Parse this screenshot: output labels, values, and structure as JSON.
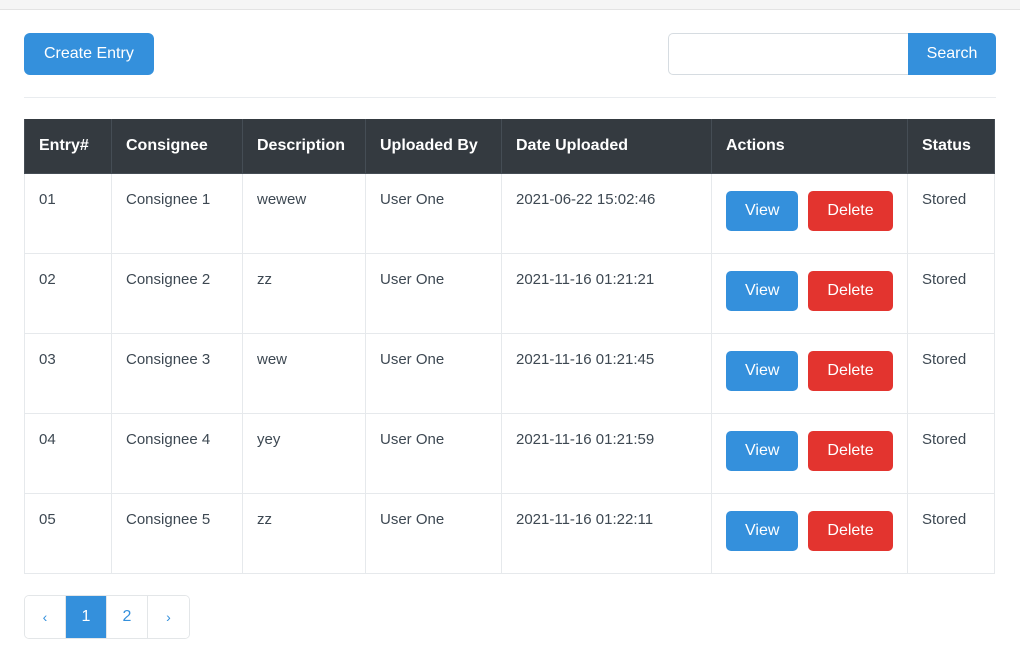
{
  "toolbar": {
    "create_label": "Create Entry",
    "search_value": "",
    "search_placeholder": "",
    "search_label": "Search"
  },
  "table": {
    "columns": [
      "Entry#",
      "Consignee",
      "Description",
      "Uploaded By",
      "Date Uploaded",
      "Actions",
      "Status"
    ],
    "action_labels": {
      "view": "View",
      "delete": "Delete"
    },
    "rows": [
      {
        "entry": "01",
        "consignee": "Consignee 1",
        "description": "wewew",
        "uploaded_by": "User One",
        "date_uploaded": "2021-06-22 15:02:46",
        "status": "Stored"
      },
      {
        "entry": "02",
        "consignee": "Consignee 2",
        "description": "zz",
        "uploaded_by": "User One",
        "date_uploaded": "2021-11-16 01:21:21",
        "status": "Stored"
      },
      {
        "entry": "03",
        "consignee": "Consignee 3",
        "description": "wew",
        "uploaded_by": "User One",
        "date_uploaded": "2021-11-16 01:21:45",
        "status": "Stored"
      },
      {
        "entry": "04",
        "consignee": "Consignee 4",
        "description": "yey",
        "uploaded_by": "User One",
        "date_uploaded": "2021-11-16 01:21:59",
        "status": "Stored"
      },
      {
        "entry": "05",
        "consignee": "Consignee 5",
        "description": "zz",
        "uploaded_by": "User One",
        "date_uploaded": "2021-11-16 01:22:11",
        "status": "Stored"
      }
    ]
  },
  "pagination": {
    "items": [
      {
        "label": "‹",
        "name": "pagination-prev",
        "active": false,
        "arrow": true
      },
      {
        "label": "1",
        "name": "pagination-page-1",
        "active": true,
        "arrow": false
      },
      {
        "label": "2",
        "name": "pagination-page-2",
        "active": false,
        "arrow": false
      },
      {
        "label": "›",
        "name": "pagination-next",
        "active": false,
        "arrow": true
      }
    ]
  },
  "colors": {
    "primary": "#3490dc",
    "danger": "#e3342f",
    "header_bg": "#343a40",
    "text": "#3d4852",
    "border": "#e6e9ec"
  }
}
